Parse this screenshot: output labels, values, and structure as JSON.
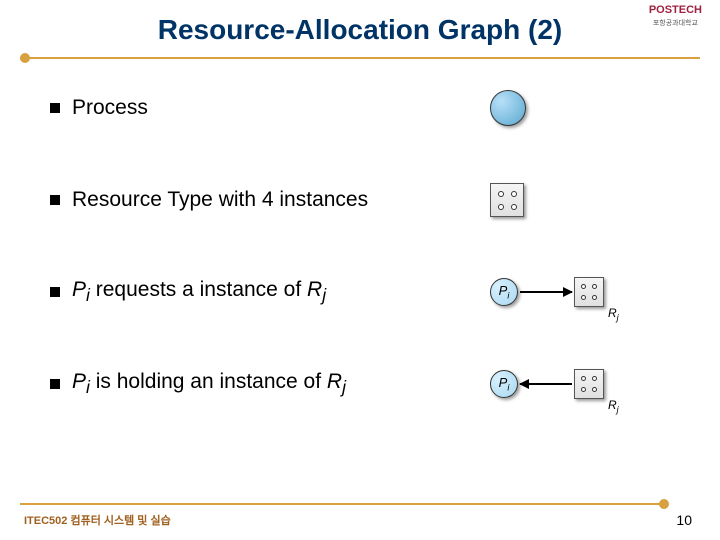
{
  "branding": {
    "name": "POSTECH",
    "subtitle": "포항공과대학교"
  },
  "title": "Resource-Allocation Graph (2)",
  "bullets": {
    "b1": "Process",
    "b2": "Resource Type with 4 instances",
    "b3_pre": "P",
    "b3_sub1": "i",
    "b3_mid": " requests a instance of ",
    "b3_r": "R",
    "b3_sub2": "j",
    "b4_pre": "P",
    "b4_sub1": "i",
    "b4_mid": " is holding an instance of ",
    "b4_r": "R",
    "b4_sub2": "j"
  },
  "labels": {
    "Pi": "P",
    "Pi_sub": "i",
    "Rj": "R",
    "Rj_sub": "j"
  },
  "footer": {
    "course": "ITEC502 컴퓨터 시스템 및 실습",
    "page": "10"
  }
}
